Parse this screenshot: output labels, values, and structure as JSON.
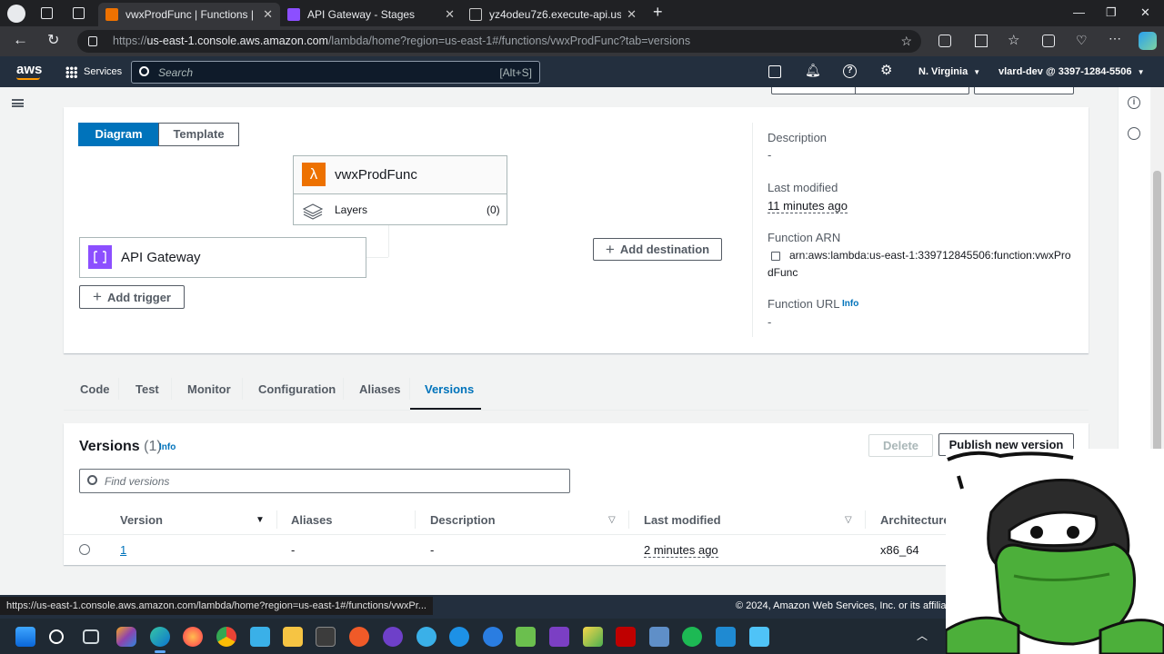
{
  "browser": {
    "tabs": [
      {
        "title": "vwxProdFunc | Functions | Lambda",
        "active": true
      },
      {
        "title": "API Gateway - Stages",
        "active": false
      },
      {
        "title": "yz4odeu7z6.execute-api.us-east-1",
        "active": false
      }
    ],
    "url_prefix": "https://",
    "url_host": "us-east-1.console.aws.amazon.com",
    "url_rest": "/lambda/home?region=us-east-1#/functions/vwxProdFunc?tab=versions"
  },
  "aws_header": {
    "logo": "aws",
    "services_label": "Services",
    "search_placeholder": "Search",
    "search_shortcut": "[Alt+S]",
    "region": "N. Virginia",
    "account": "vlard-dev @ 3397-1284-5506"
  },
  "overview": {
    "diagram_tab": "Diagram",
    "template_tab": "Template",
    "function_name": "vwxProdFunc",
    "layers_label": "Layers",
    "layers_count": "(0)",
    "trigger_name": "API Gateway",
    "add_trigger": "Add trigger",
    "add_destination": "Add destination",
    "description_label": "Description",
    "description_value": "-",
    "last_modified_label": "Last modified",
    "last_modified_value": "11 minutes ago",
    "arn_label": "Function ARN",
    "arn_line1": "arn:aws:lambda:us-east-1:339712845506:function:vwxPro",
    "arn_line2": "dFunc",
    "function_url_label": "Function URL",
    "function_url_info": "Info",
    "function_url_value": "-"
  },
  "detail_tabs": [
    "Code",
    "Test",
    "Monitor",
    "Configuration",
    "Aliases",
    "Versions"
  ],
  "active_tab": "Versions",
  "versions": {
    "title": "Versions",
    "count": "(1)",
    "info": "Info",
    "delete_label": "Delete",
    "publish_label": "Publish new version",
    "search_placeholder": "Find versions",
    "columns": [
      "Version",
      "Aliases",
      "Description",
      "Last modified",
      "Architecture"
    ],
    "rows": [
      {
        "version": "1",
        "aliases": "-",
        "description": "-",
        "last_modified": "2 minutes ago",
        "architecture": "x86_64"
      }
    ]
  },
  "footer": {
    "copyright": "© 2024, Amazon Web Services, Inc. or its affiliates."
  },
  "status_url": "https://us-east-1.console.aws.amazon.com/lambda/home?region=us-east-1#/functions/vwxPr...",
  "colors": {
    "aws_header": "#232f3e",
    "primary": "#0073bb",
    "lambda_orange": "#ed7100",
    "apigw_purple": "#8c4fff"
  }
}
